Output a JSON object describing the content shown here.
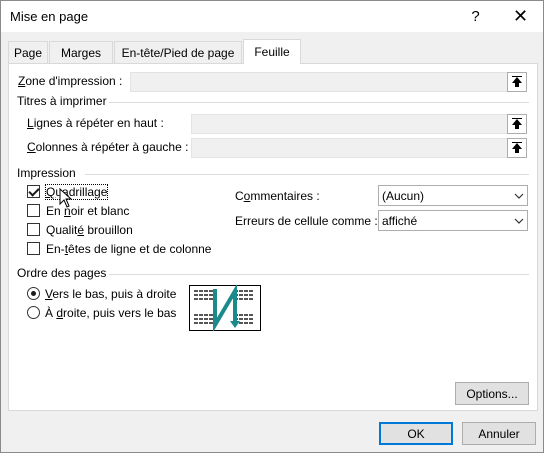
{
  "window": {
    "title": "Mise en page",
    "help_glyph": "?",
    "close_glyph": "✕"
  },
  "tabs": [
    {
      "label": "Page"
    },
    {
      "label": "Marges"
    },
    {
      "label": "En-tête/Pied de page"
    },
    {
      "label": "Feuille"
    }
  ],
  "active_tab": "Feuille",
  "print_area": {
    "label_u": "Z",
    "label_rest": "one d'impression :",
    "value": ""
  },
  "titles_group": {
    "title": "Titres à imprimer"
  },
  "rows_repeat": {
    "label_u": "L",
    "label_rest": "ignes à répéter en haut :",
    "value": ""
  },
  "cols_repeat": {
    "label_u": "C",
    "label_rest": "olonnes à répéter à gauche :",
    "value": ""
  },
  "print_group": {
    "title": "Impression"
  },
  "checkboxes": [
    {
      "label_u": "Q",
      "label_rest": "uadrillage",
      "checked": true
    },
    {
      "label_pre": "En ",
      "label_u": "n",
      "label_rest": "oir et blanc",
      "checked": false
    },
    {
      "label_pre": "Qualit",
      "label_u": "é",
      "label_rest": " brouillon",
      "checked": false
    },
    {
      "label_pre": "En-",
      "label_u": "t",
      "label_rest": "êtes de ligne et de colonne",
      "checked": false
    }
  ],
  "comments": {
    "label_pre": "C",
    "label_u": "o",
    "label_rest": "mmentaires :",
    "value": "(Aucun)"
  },
  "cell_errors": {
    "label_pre": "Erreurs de cellule comme :",
    "value": "affiché"
  },
  "order_group": {
    "title": "Ordre des pages"
  },
  "radios": [
    {
      "label_u": "V",
      "label_rest": "ers le bas, puis à droite",
      "selected": true
    },
    {
      "label_pre": "À ",
      "label_u": "d",
      "label_rest": "roite, puis vers le bas",
      "selected": false
    }
  ],
  "buttons": {
    "options": "Options...",
    "ok": "OK",
    "cancel": "Annuler"
  },
  "colors": {
    "accent": "#0078d7",
    "order_arrow": "#1a8a8a"
  }
}
